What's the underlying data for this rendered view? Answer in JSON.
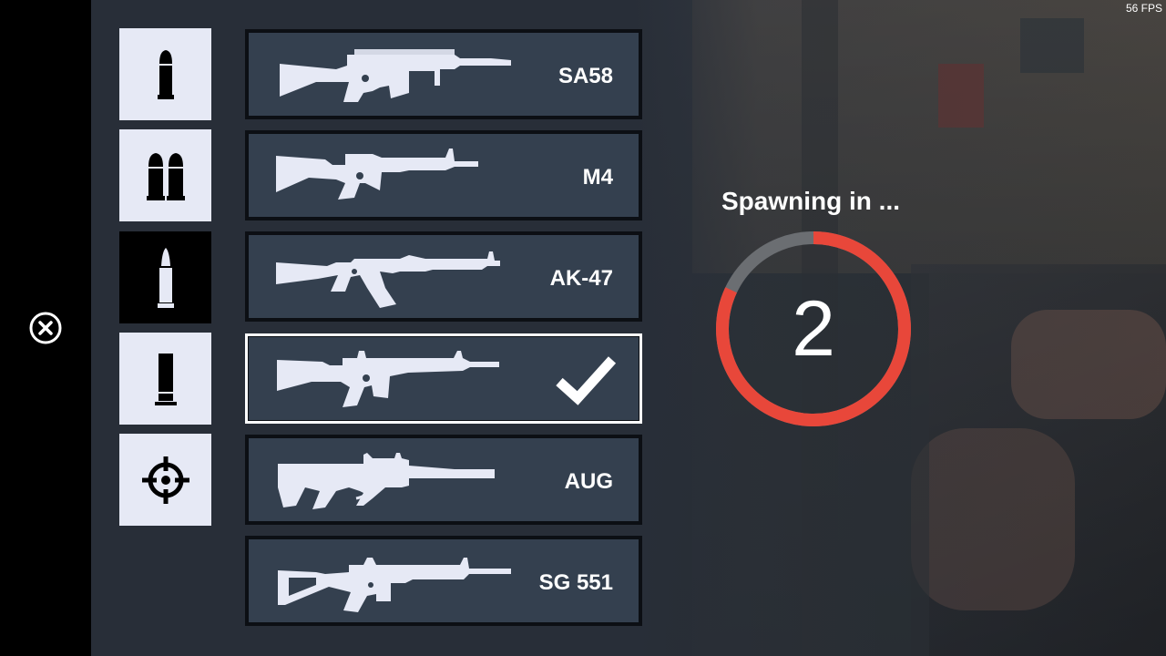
{
  "hud": {
    "fps": "56 FPS"
  },
  "categories": [
    {
      "icon": "single-bullet-icon",
      "active": false
    },
    {
      "icon": "double-bullet-icon",
      "active": false
    },
    {
      "icon": "rifle-bullet-icon",
      "active": true
    },
    {
      "icon": "shotgun-shell-icon",
      "active": false
    },
    {
      "icon": "crosshair-icon",
      "active": false
    }
  ],
  "weapons": [
    {
      "name": "SA58",
      "selected": false
    },
    {
      "name": "M4",
      "selected": false
    },
    {
      "name": "AK-47",
      "selected": false
    },
    {
      "name": "",
      "selected": true
    },
    {
      "name": "AUG",
      "selected": false
    },
    {
      "name": "SG 551",
      "selected": false
    }
  ],
  "spawn": {
    "title": "Spawning in ...",
    "countdown": "2",
    "progress": 0.82,
    "ring_color": "#e8473a",
    "ring_track_color": "#6b6e72"
  },
  "colors": {
    "panel": "#34404f",
    "category_bg": "#e6e9f5",
    "category_active_bg": "#000000"
  }
}
